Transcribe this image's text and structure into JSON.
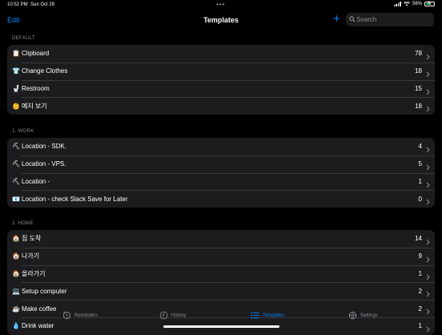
{
  "status_bar": {
    "time": "10:52 PM",
    "date": "Sun Oct 29",
    "battery": "56%",
    "dots": "•••"
  },
  "nav": {
    "edit": "Edit",
    "title": "Templates",
    "add": "+",
    "search_placeholder": "Search"
  },
  "colors": {
    "accent": "#0a84ff",
    "battery": "#34c759",
    "row_bg": "#1c1c1e"
  },
  "sections": [
    {
      "header": "DEFAULT",
      "rows": [
        {
          "emoji": "📋",
          "label": "Clipboard",
          "count": "78"
        },
        {
          "emoji": "👕",
          "label": "Change Clothes",
          "count": "18"
        },
        {
          "emoji": "🚽",
          "label": "Restroom",
          "count": "15"
        },
        {
          "emoji": "👶",
          "label": "예지 보기",
          "count": "18"
        }
      ]
    },
    {
      "header": "1. WORK",
      "rows": [
        {
          "emoji": "⛏",
          "label": "Location - SDK.",
          "count": "4"
        },
        {
          "emoji": "⛏",
          "label": "Location - VPS.",
          "count": "5"
        },
        {
          "emoji": "⛏",
          "label": "Location -",
          "count": "1"
        },
        {
          "emoji": "📧",
          "label": "Location - check Slack Save for Later",
          "count": "0"
        }
      ]
    },
    {
      "header": "2. HOME",
      "rows": [
        {
          "emoji": "🏠",
          "label": "집 도착",
          "count": "14"
        },
        {
          "emoji": "🏠",
          "label": "나가기",
          "count": "9"
        },
        {
          "emoji": "🏠",
          "label": "올라가기",
          "count": "1"
        },
        {
          "emoji": "💻",
          "label": "Setup computer",
          "count": "2"
        },
        {
          "emoji": "☕",
          "label": "Make coffee",
          "count": "2"
        },
        {
          "emoji": "💧",
          "label": "Drink water",
          "count": "1"
        }
      ]
    }
  ],
  "tabs": [
    {
      "label": "Reminders",
      "icon": "reminders-clock-icon"
    },
    {
      "label": "History",
      "icon": "history-clock-icon"
    },
    {
      "label": "Templates",
      "icon": "list-icon",
      "active": true
    },
    {
      "label": "Settings",
      "icon": "gear-icon"
    }
  ]
}
